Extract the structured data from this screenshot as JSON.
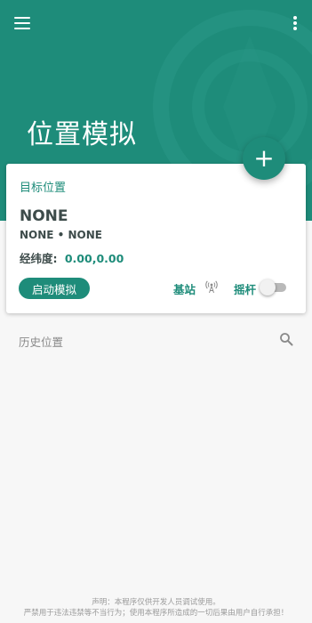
{
  "header": {
    "title": "位置模拟",
    "menu_icon": "hamburger-menu-icon",
    "more_icon": "more-vertical-icon",
    "color": "#1e8c7a"
  },
  "fab": {
    "label": "+",
    "icon": "add-icon"
  },
  "card": {
    "section_label": "目标位置",
    "location_name": "NONE",
    "location_sub": "NONE • NONE",
    "coords_label": "经纬度:",
    "coords_value": "0.00,0.00",
    "start_button": "启动模拟",
    "base_station_label": "基站",
    "base_station_icon": "antenna-icon",
    "joystick_label": "摇杆",
    "joystick_enabled": false
  },
  "history": {
    "label": "历史位置",
    "search_icon": "search-icon"
  },
  "footer": {
    "line1": "声明：本程序仅供开发人员调试使用。",
    "line2": "严禁用于违法违禁等不当行为；使用本程序所造成的一切后果由用户自行承担！"
  }
}
